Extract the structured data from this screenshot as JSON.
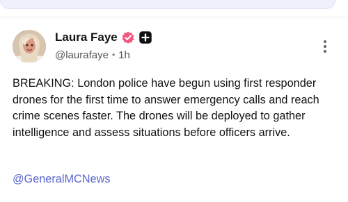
{
  "post": {
    "author": {
      "display_name": "Laura Faye",
      "handle": "@laurafaye",
      "time_ago": "1h",
      "separator": "•",
      "avatar_icon": "profile-photo",
      "verified_icon": "verified-badge-icon",
      "plus_icon": "plus-badge-icon"
    },
    "text": "BREAKING: London police have begun using first responder drones for the first time to answer emergency calls and reach crime scenes faster. The drones will be deployed to gather intelligence and assess situations before officers arrive.",
    "mention": "@GeneralMCNews",
    "more_icon": "more-vertical-icon"
  },
  "colors": {
    "verified_badge": "#ef5c7f",
    "plus_badge": "#111111",
    "mention_link": "#5b67cc",
    "top_strip": "#eef0fb"
  }
}
